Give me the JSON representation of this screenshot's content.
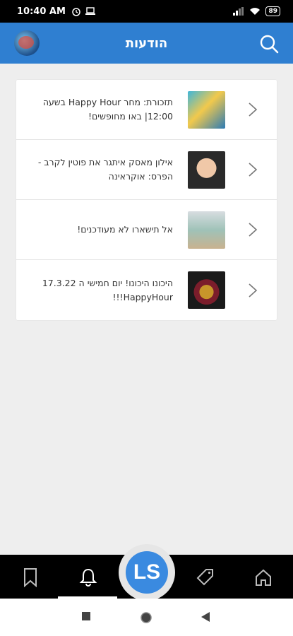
{
  "status_bar": {
    "time": "10:40 AM",
    "battery": "89",
    "icons": [
      "alarm-icon",
      "laptop-icon",
      "signal-icon",
      "wifi-icon",
      "battery-icon"
    ]
  },
  "header": {
    "title": "הודעות",
    "left_icon": "avatar",
    "right_icon": "search-icon",
    "background_color": "#2f7fd1"
  },
  "notifications": [
    {
      "text": "תזכורת: מחר Happy Hour בשעה 12:00| באו מחופשים!",
      "thumb": "festival-image"
    },
    {
      "text": "אילון מאסק איתגר את פוטין לקרב - הפרס: אוקראינה",
      "thumb": "portrait-image"
    },
    {
      "text": "אל תישארו לא מעודכנים!",
      "thumb": "shirt-image"
    },
    {
      "text": "היכונו היכונו! יום חמישי ה 17.3.22 HappyHour!!!",
      "thumb": "mask-image"
    }
  ],
  "bottom_nav": {
    "items": [
      "bookmark-icon",
      "bell-icon",
      "ls-logo",
      "tag-icon",
      "home-icon"
    ],
    "active": "bell-icon",
    "logo_text": "LS"
  },
  "system_nav": [
    "recents-square-icon",
    "home-circle-icon",
    "back-triangle-icon"
  ]
}
